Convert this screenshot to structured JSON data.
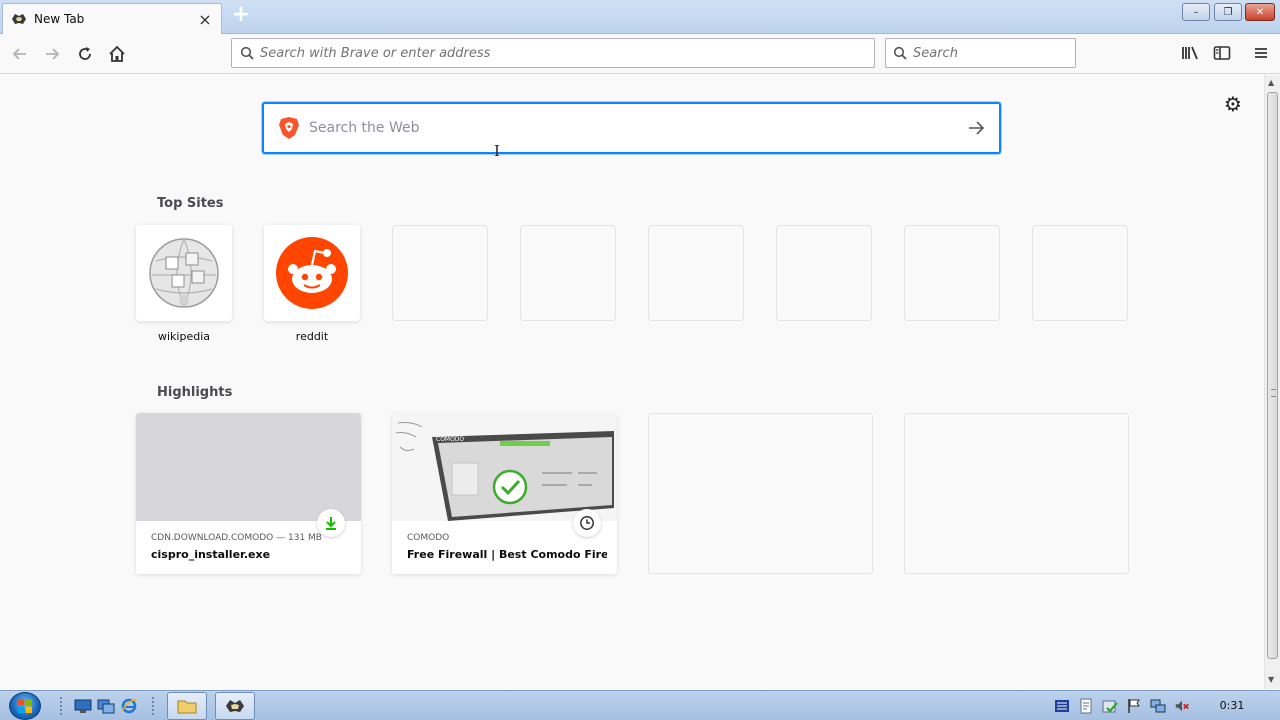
{
  "browser": {
    "tab": {
      "title": "New Tab",
      "close_icon": "close-icon"
    },
    "new_tab_symbol": "+",
    "address_placeholder": "Search with Brave or enter address",
    "search_placeholder": "Search",
    "window_controls": {
      "minimize": "–",
      "maximize": "❐",
      "close": "✕"
    }
  },
  "newtab": {
    "web_search_placeholder": "Search the Web",
    "top_sites_title": "Top Sites",
    "top_sites": [
      {
        "label": "wikipedia",
        "icon": "wikipedia-globe-icon"
      },
      {
        "label": "reddit",
        "icon": "reddit-alien-icon"
      },
      {
        "label": "",
        "icon": ""
      },
      {
        "label": "",
        "icon": ""
      },
      {
        "label": "",
        "icon": ""
      },
      {
        "label": "",
        "icon": ""
      },
      {
        "label": "",
        "icon": ""
      },
      {
        "label": "",
        "icon": ""
      }
    ],
    "highlights_title": "Highlights",
    "highlights": [
      {
        "context": "CDN.DOWNLOAD.COMODO — 131 MB",
        "title": "cispro_installer.exe",
        "badge_icon": "download-icon"
      },
      {
        "context": "COMODO",
        "title": "Free Firewall | Best Comodo Fire...",
        "badge_icon": "clock-icon",
        "thumb_text": "COMODO"
      }
    ]
  },
  "taskbar": {
    "clock": "0:31"
  },
  "colors": {
    "accent": "#0a84ff",
    "reddit": "#ff4500",
    "brave": "#fb542b",
    "download_green": "#12bc00"
  }
}
